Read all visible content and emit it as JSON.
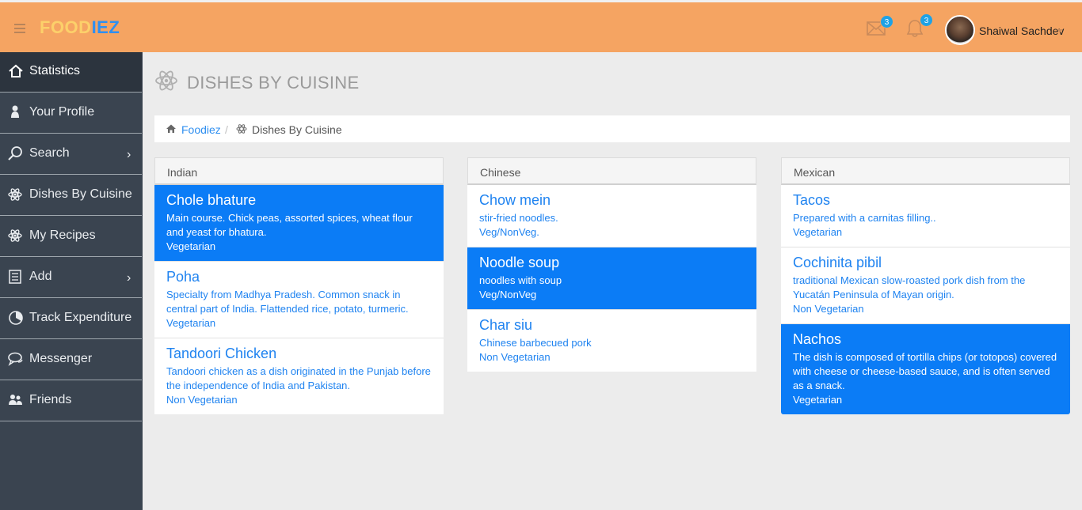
{
  "header": {
    "brand_part1": "FOOD",
    "brand_part2": "IEZ",
    "mail_count": "3",
    "notif_count": "3",
    "user_name": "Shaiwal Sachdev"
  },
  "sidebar": {
    "items": [
      {
        "label": "Statistics",
        "icon": "home-icon"
      },
      {
        "label": "Your Profile",
        "icon": "user-icon"
      },
      {
        "label": "Search",
        "icon": "search-icon"
      },
      {
        "label": "Dishes By Cuisine",
        "icon": "atom-icon"
      },
      {
        "label": "My Recipes",
        "icon": "atom-icon"
      },
      {
        "label": "Add",
        "icon": "list-icon"
      },
      {
        "label": "Track Expenditure",
        "icon": "pie-chart-icon"
      },
      {
        "label": "Messenger",
        "icon": "chat-icon"
      },
      {
        "label": "Friends",
        "icon": "users-icon"
      }
    ]
  },
  "page": {
    "title": "DISHES BY CUISINE",
    "breadcrumb_root": "Foodiez",
    "breadcrumb_current": "Dishes By Cuisine"
  },
  "cuisines": [
    {
      "name": "Indian",
      "dishes": [
        {
          "title": "Chole bhature",
          "desc": "Main course. Chick peas, assorted spices, wheat flour and yeast for bhatura.",
          "veg": "Vegetarian",
          "active": true
        },
        {
          "title": "Poha",
          "desc": "Specialty from Madhya Pradesh. Common snack in central part of India. Flattended rice, potato, turmeric.",
          "veg": "Vegetarian",
          "active": false
        },
        {
          "title": "Tandoori Chicken",
          "desc": "Tandoori chicken as a dish originated in the Punjab before the independence of India and Pakistan.",
          "veg": "Non Vegetarian",
          "active": false
        }
      ]
    },
    {
      "name": "Chinese",
      "dishes": [
        {
          "title": "Chow mein",
          "desc": "stir-fried noodles.",
          "veg": "Veg/NonVeg.",
          "active": false
        },
        {
          "title": "Noodle soup",
          "desc": "noodles with soup",
          "veg": "Veg/NonVeg",
          "active": true
        },
        {
          "title": "Char siu",
          "desc": "Chinese barbecued pork",
          "veg": "Non Vegetarian",
          "active": false
        }
      ]
    },
    {
      "name": "Mexican",
      "dishes": [
        {
          "title": "Tacos",
          "desc": "Prepared with a carnitas filling..",
          "veg": "Vegetarian",
          "active": false
        },
        {
          "title": "Cochinita pibil",
          "desc": "traditional Mexican slow-roasted pork dish from the Yucatán Peninsula of Mayan origin.",
          "veg": "Non Vegetarian",
          "active": false
        },
        {
          "title": "Nachos",
          "desc": "The dish is composed of tortilla chips (or totopos) covered with cheese or cheese-based sauce, and is often served as a snack.",
          "veg": "Vegetarian",
          "active": true
        }
      ]
    }
  ],
  "colors": {
    "header_bg": "#f5a462",
    "sidebar_bg": "#3a4450",
    "accent_blue": "#0b7cf6",
    "link_blue": "#1f83f0"
  }
}
